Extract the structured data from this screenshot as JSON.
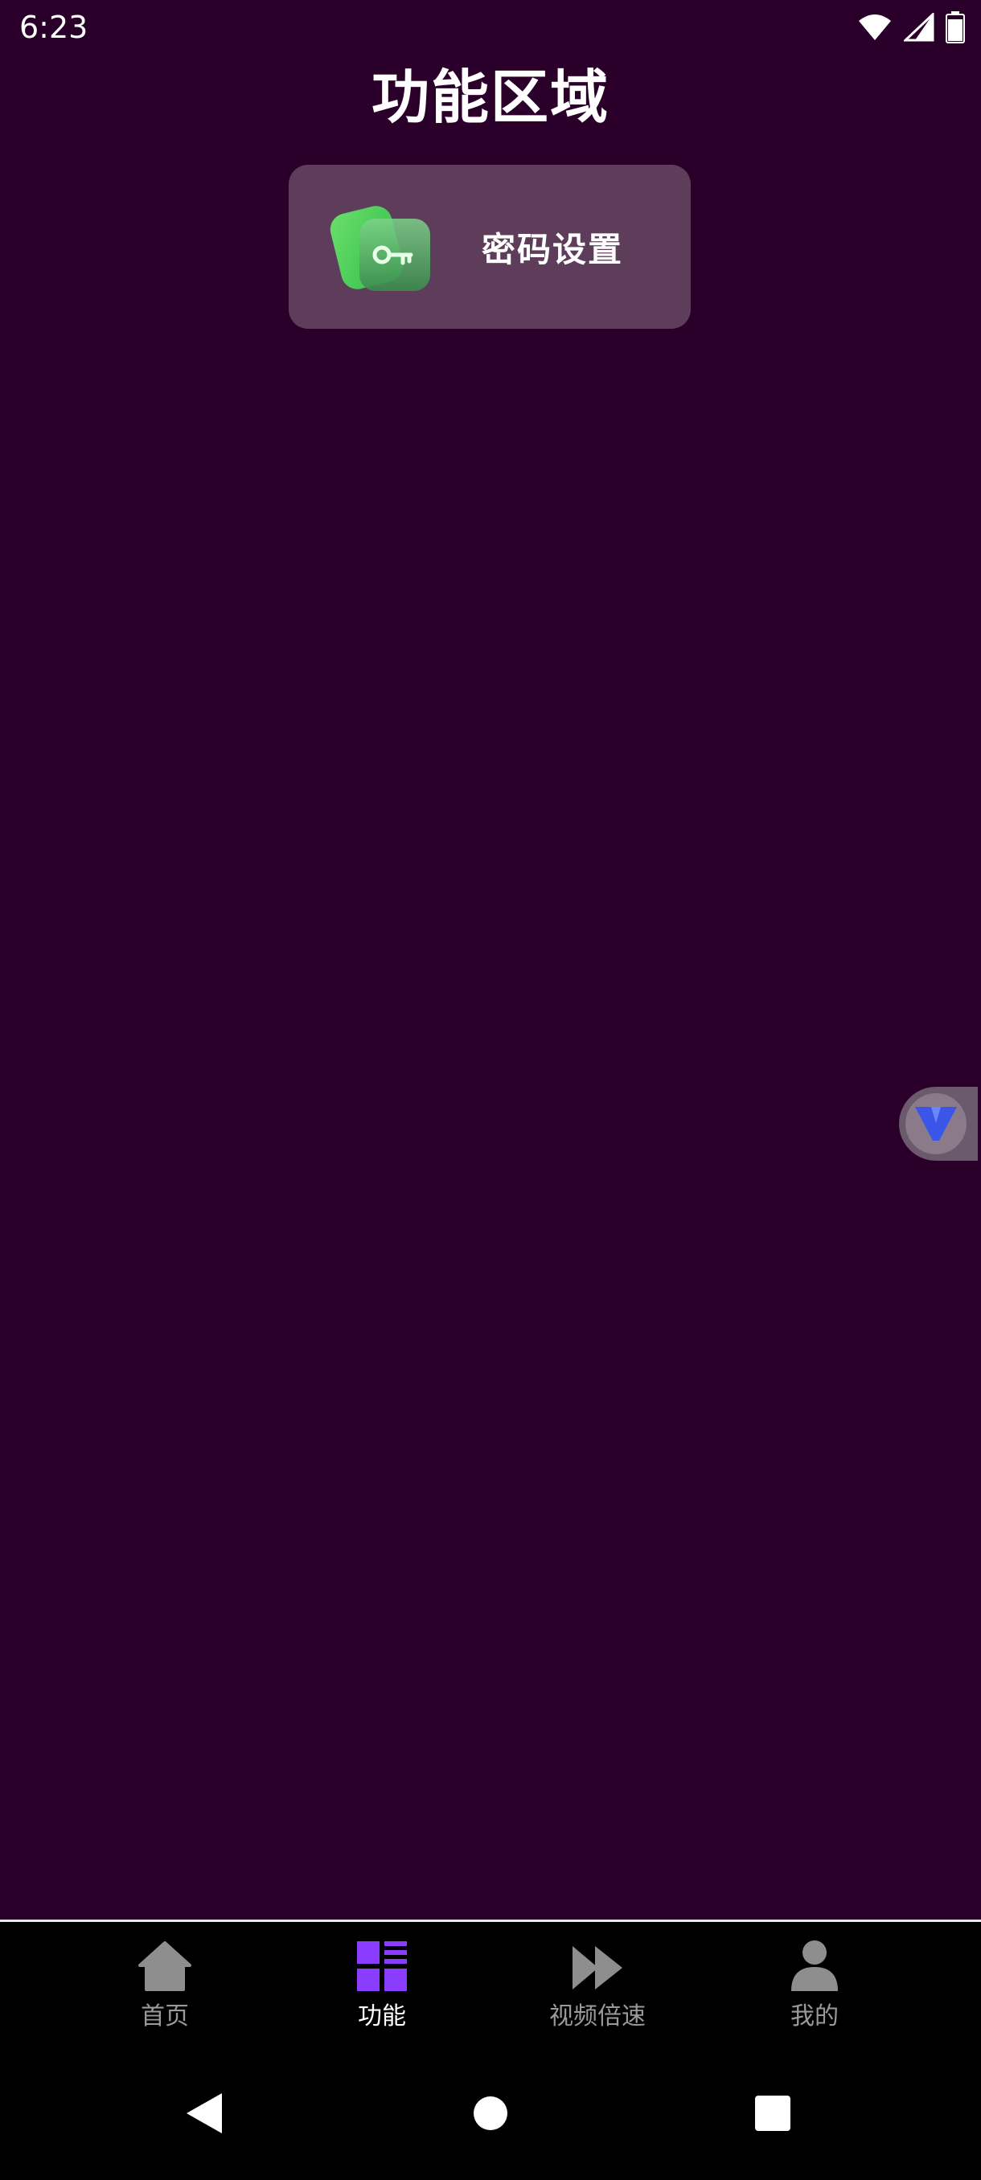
{
  "status_bar": {
    "time": "6:23"
  },
  "page": {
    "title": "功能区域"
  },
  "features": [
    {
      "label": "密码设置",
      "icon": "key-icon"
    }
  ],
  "tabs": [
    {
      "label": "首页",
      "icon": "home-icon",
      "active": false
    },
    {
      "label": "功能",
      "icon": "feature-grid-icon",
      "active": true
    },
    {
      "label": "视频倍速",
      "icon": "fast-forward-icon",
      "active": false
    },
    {
      "label": "我的",
      "icon": "person-icon",
      "active": false
    }
  ],
  "colors": {
    "background": "#2a002a",
    "card": "#5e3d5b",
    "accent": "#8b3dff",
    "key_green": "#4cd25a",
    "tab_inactive": "#9a9a9a"
  }
}
